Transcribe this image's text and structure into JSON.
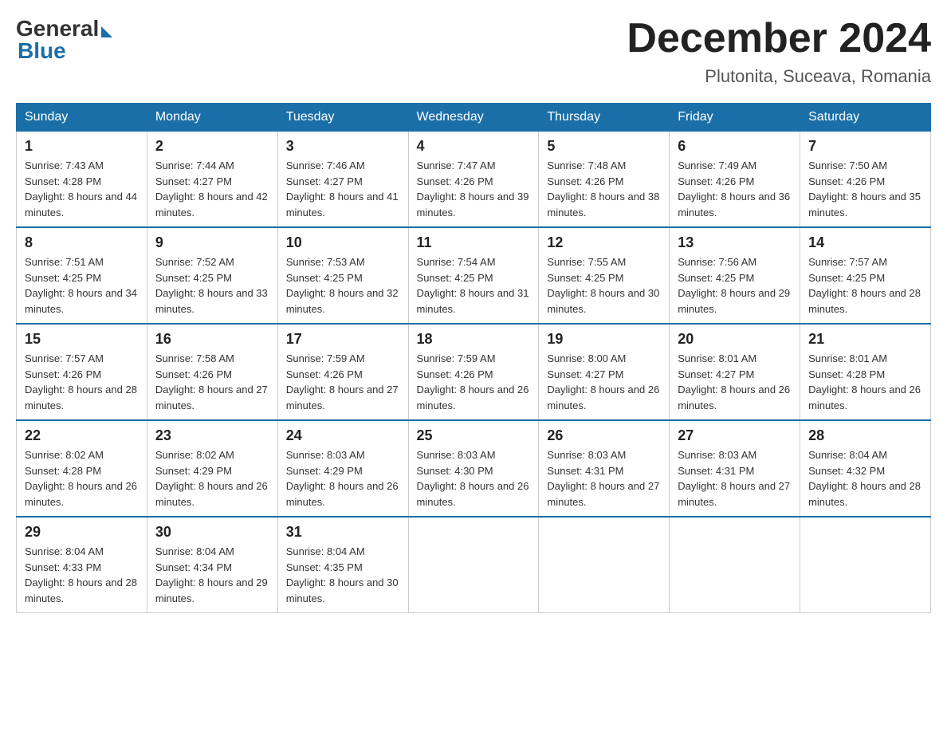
{
  "header": {
    "logo": {
      "general": "General",
      "blue": "Blue"
    },
    "title": "December 2024",
    "subtitle": "Plutonita, Suceava, Romania"
  },
  "calendar": {
    "days_of_week": [
      "Sunday",
      "Monday",
      "Tuesday",
      "Wednesday",
      "Thursday",
      "Friday",
      "Saturday"
    ],
    "weeks": [
      [
        {
          "day": "1",
          "sunrise": "7:43 AM",
          "sunset": "4:28 PM",
          "daylight": "8 hours and 44 minutes."
        },
        {
          "day": "2",
          "sunrise": "7:44 AM",
          "sunset": "4:27 PM",
          "daylight": "8 hours and 42 minutes."
        },
        {
          "day": "3",
          "sunrise": "7:46 AM",
          "sunset": "4:27 PM",
          "daylight": "8 hours and 41 minutes."
        },
        {
          "day": "4",
          "sunrise": "7:47 AM",
          "sunset": "4:26 PM",
          "daylight": "8 hours and 39 minutes."
        },
        {
          "day": "5",
          "sunrise": "7:48 AM",
          "sunset": "4:26 PM",
          "daylight": "8 hours and 38 minutes."
        },
        {
          "day": "6",
          "sunrise": "7:49 AM",
          "sunset": "4:26 PM",
          "daylight": "8 hours and 36 minutes."
        },
        {
          "day": "7",
          "sunrise": "7:50 AM",
          "sunset": "4:26 PM",
          "daylight": "8 hours and 35 minutes."
        }
      ],
      [
        {
          "day": "8",
          "sunrise": "7:51 AM",
          "sunset": "4:25 PM",
          "daylight": "8 hours and 34 minutes."
        },
        {
          "day": "9",
          "sunrise": "7:52 AM",
          "sunset": "4:25 PM",
          "daylight": "8 hours and 33 minutes."
        },
        {
          "day": "10",
          "sunrise": "7:53 AM",
          "sunset": "4:25 PM",
          "daylight": "8 hours and 32 minutes."
        },
        {
          "day": "11",
          "sunrise": "7:54 AM",
          "sunset": "4:25 PM",
          "daylight": "8 hours and 31 minutes."
        },
        {
          "day": "12",
          "sunrise": "7:55 AM",
          "sunset": "4:25 PM",
          "daylight": "8 hours and 30 minutes."
        },
        {
          "day": "13",
          "sunrise": "7:56 AM",
          "sunset": "4:25 PM",
          "daylight": "8 hours and 29 minutes."
        },
        {
          "day": "14",
          "sunrise": "7:57 AM",
          "sunset": "4:25 PM",
          "daylight": "8 hours and 28 minutes."
        }
      ],
      [
        {
          "day": "15",
          "sunrise": "7:57 AM",
          "sunset": "4:26 PM",
          "daylight": "8 hours and 28 minutes."
        },
        {
          "day": "16",
          "sunrise": "7:58 AM",
          "sunset": "4:26 PM",
          "daylight": "8 hours and 27 minutes."
        },
        {
          "day": "17",
          "sunrise": "7:59 AM",
          "sunset": "4:26 PM",
          "daylight": "8 hours and 27 minutes."
        },
        {
          "day": "18",
          "sunrise": "7:59 AM",
          "sunset": "4:26 PM",
          "daylight": "8 hours and 26 minutes."
        },
        {
          "day": "19",
          "sunrise": "8:00 AM",
          "sunset": "4:27 PM",
          "daylight": "8 hours and 26 minutes."
        },
        {
          "day": "20",
          "sunrise": "8:01 AM",
          "sunset": "4:27 PM",
          "daylight": "8 hours and 26 minutes."
        },
        {
          "day": "21",
          "sunrise": "8:01 AM",
          "sunset": "4:28 PM",
          "daylight": "8 hours and 26 minutes."
        }
      ],
      [
        {
          "day": "22",
          "sunrise": "8:02 AM",
          "sunset": "4:28 PM",
          "daylight": "8 hours and 26 minutes."
        },
        {
          "day": "23",
          "sunrise": "8:02 AM",
          "sunset": "4:29 PM",
          "daylight": "8 hours and 26 minutes."
        },
        {
          "day": "24",
          "sunrise": "8:03 AM",
          "sunset": "4:29 PM",
          "daylight": "8 hours and 26 minutes."
        },
        {
          "day": "25",
          "sunrise": "8:03 AM",
          "sunset": "4:30 PM",
          "daylight": "8 hours and 26 minutes."
        },
        {
          "day": "26",
          "sunrise": "8:03 AM",
          "sunset": "4:31 PM",
          "daylight": "8 hours and 27 minutes."
        },
        {
          "day": "27",
          "sunrise": "8:03 AM",
          "sunset": "4:31 PM",
          "daylight": "8 hours and 27 minutes."
        },
        {
          "day": "28",
          "sunrise": "8:04 AM",
          "sunset": "4:32 PM",
          "daylight": "8 hours and 28 minutes."
        }
      ],
      [
        {
          "day": "29",
          "sunrise": "8:04 AM",
          "sunset": "4:33 PM",
          "daylight": "8 hours and 28 minutes."
        },
        {
          "day": "30",
          "sunrise": "8:04 AM",
          "sunset": "4:34 PM",
          "daylight": "8 hours and 29 minutes."
        },
        {
          "day": "31",
          "sunrise": "8:04 AM",
          "sunset": "4:35 PM",
          "daylight": "8 hours and 30 minutes."
        },
        null,
        null,
        null,
        null
      ]
    ]
  }
}
